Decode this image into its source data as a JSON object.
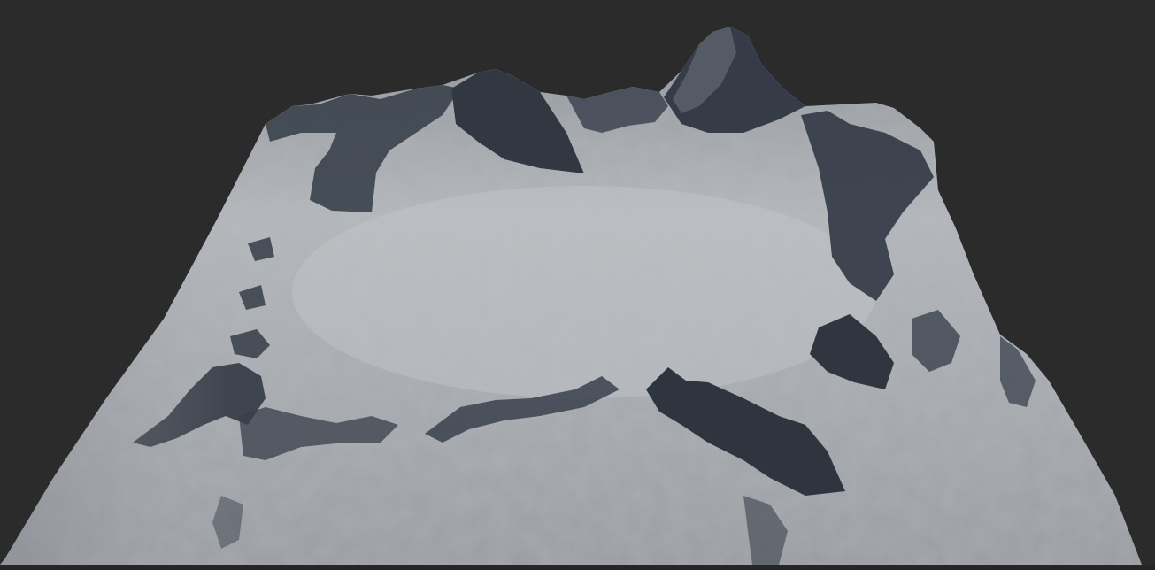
{
  "viewport": {
    "background": "#2b2b2b"
  },
  "terrain": {
    "base_color": "#a9acb1",
    "lit_color": "#c4c6ca",
    "shadow_color": "#2f3540",
    "deep_shadow_color": "#242a33"
  }
}
